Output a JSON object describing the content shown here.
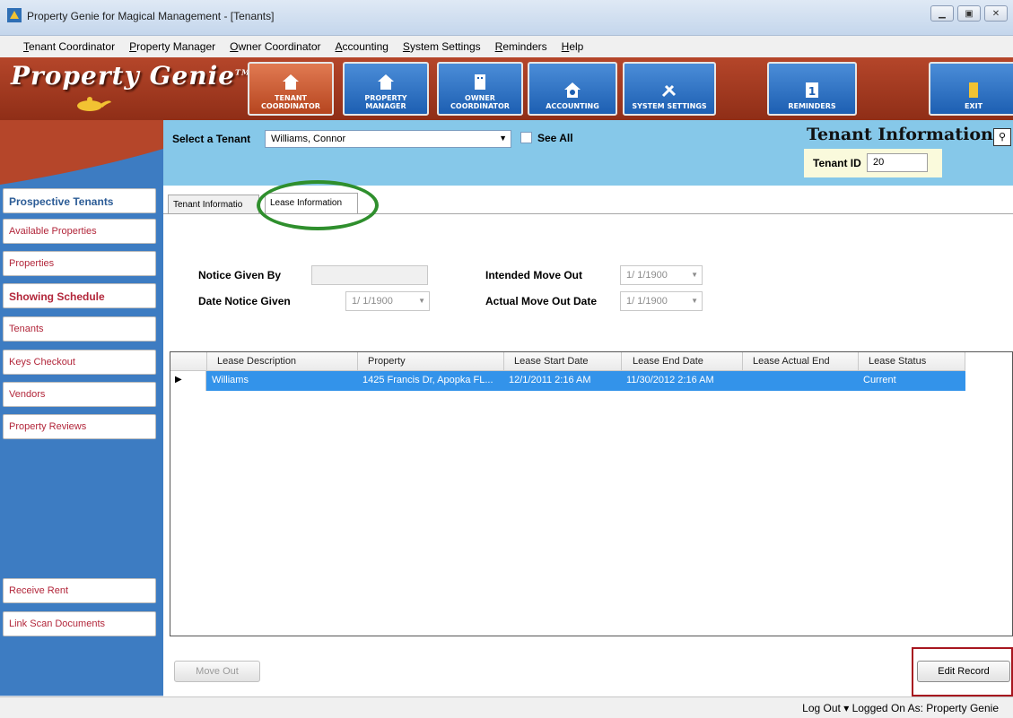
{
  "window": {
    "title": "Property Genie for Magical Management - [Tenants]"
  },
  "menu": [
    {
      "u": "T",
      "rest": "enant Coordinator"
    },
    {
      "u": "P",
      "rest": "roperty Manager"
    },
    {
      "u": "O",
      "rest": "wner Coordinator"
    },
    {
      "u": "A",
      "rest": "ccounting"
    },
    {
      "u": "S",
      "rest": "ystem Settings"
    },
    {
      "u": "R",
      "rest": "eminders"
    },
    {
      "u": "H",
      "rest": "elp"
    }
  ],
  "banner": {
    "logo": "Property Genie",
    "tm": "TM",
    "nav": {
      "tenant_coordinator": [
        "TENANT",
        "COORDINATOR"
      ],
      "property_manager": [
        "PROPERTY",
        "MANAGER"
      ],
      "owner_coordinator": [
        "OWNER",
        "COORDINATOR"
      ],
      "accounting": "ACCOUNTING",
      "system_settings": "SYSTEM SETTINGS",
      "reminders": "REMINDERS",
      "exit": "EXIT"
    },
    "colors": {
      "accent_active": "#b6451f",
      "nav_blue": "#1d5fb2"
    }
  },
  "sidebar": {
    "items": [
      "Prospective Tenants",
      "Available Properties",
      "Properties",
      "Showing Schedule",
      "Tenants",
      "Keys Checkout",
      "Vendors",
      "Property Reviews",
      "Receive Rent",
      "Link Scan Documents"
    ]
  },
  "header": {
    "select_label": "Select a Tenant",
    "selected_tenant": "Williams, Connor",
    "see_all_label": "See All",
    "section_title": "Tenant Information",
    "tenant_id_label": "Tenant ID",
    "tenant_id_value": "20"
  },
  "tabs": {
    "tenant_information": "Tenant Informatio",
    "lease_information": "Lease Information"
  },
  "form": {
    "notice_given_by_label": "Notice Given By",
    "notice_given_by_value": "",
    "date_notice_given_label": "Date Notice Given",
    "date_notice_given_value": "1/ 1/1900",
    "intended_move_out_label": "Intended Move Out",
    "intended_move_out_value": "1/ 1/1900",
    "actual_move_out_label": "Actual Move Out Date",
    "actual_move_out_value": "1/ 1/1900"
  },
  "grid": {
    "columns": [
      "Lease Description",
      "Property",
      "Lease Start Date",
      "Lease End Date",
      "Lease Actual End",
      "Lease Status"
    ],
    "rows": [
      [
        "Williams",
        "1425 Francis Dr, Apopka FL...",
        "12/1/2011 2:16 AM",
        "11/30/2012 2:16 AM",
        "",
        "Current"
      ]
    ]
  },
  "buttons": {
    "move_out": "Move Out",
    "edit_record": "Edit Record"
  },
  "status": {
    "log_out": "Log Out",
    "logged_on": "Logged On As: Property Genie"
  }
}
